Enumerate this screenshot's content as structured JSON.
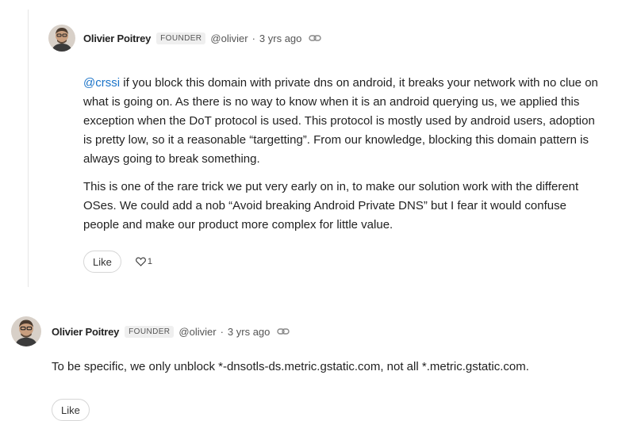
{
  "comments": [
    {
      "author": "Olivier Poitrey",
      "badge": "FOUNDER",
      "handle": "@olivier",
      "separator": "·",
      "time": "3 yrs ago",
      "paragraphs": [
        {
          "mention": "@crssi",
          "text": " if you block this domain with private dns on android, it breaks your network with no clue on what is going on. As there is no way to know when it is an android querying us, we applied this exception when the DoT protocol is used. This protocol is mostly used by android users, adoption is pretty low, so it a reasonable “targetting”. From our knowledge, blocking this domain pattern is always going to break something."
        },
        {
          "text": "This is one of the rare trick we put very early on in, to make our solution work with the different OSes. We could add a nob “Avoid breaking Android Private DNS” but I fear it would confuse people and make our product more complex for little value."
        }
      ],
      "like_label": "Like",
      "like_count": "1"
    },
    {
      "author": "Olivier Poitrey",
      "badge": "FOUNDER",
      "handle": "@olivier",
      "separator": "·",
      "time": "3 yrs ago",
      "paragraphs": [
        {
          "text": "To be specific, we only unblock *-dnsotls-ds.metric.gstatic.com, not all *.metric.gstatic.com."
        }
      ],
      "like_label": "Like"
    }
  ],
  "icons": {
    "permalink": "link-icon",
    "like": "heart-icon"
  },
  "colors": {
    "mention": "#1a73c8",
    "badge_bg": "#efefef"
  }
}
